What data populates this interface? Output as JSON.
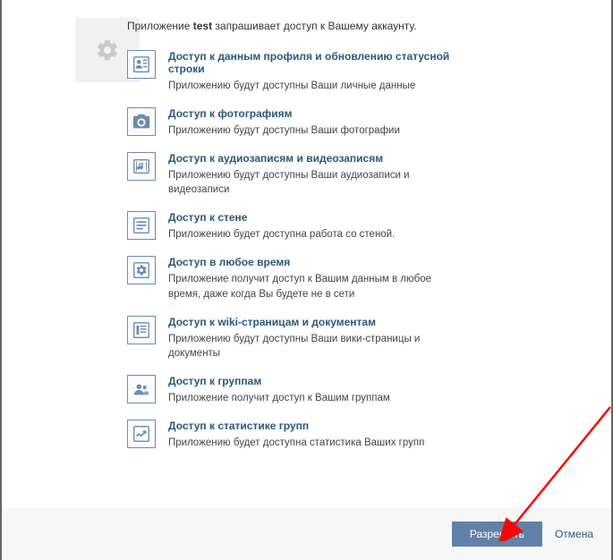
{
  "intro_prefix": "Приложение ",
  "app_name": "test",
  "intro_suffix": " запрашивает доступ к Вашему аккаунту.",
  "permissions": [
    {
      "icon": "profile",
      "title": "Доступ к данным профиля и обновлению статусной строки",
      "desc": "Приложению будут доступны Ваши личные данные"
    },
    {
      "icon": "photos",
      "title": "Доступ к фотографиям",
      "desc": "Приложению будут доступны Ваши фотографии"
    },
    {
      "icon": "audio",
      "title": "Доступ к аудиозаписям и видеозаписям",
      "desc": "Приложению будут доступны Ваши аудиозаписи и видеозаписи"
    },
    {
      "icon": "wall",
      "title": "Доступ к стене",
      "desc": "Приложению будет доступна работа со стеной."
    },
    {
      "icon": "offline",
      "title": "Доступ в любое время",
      "desc": "Приложение получит доступ к Вашим данным в любое время, даже когда Вы будете не в сети"
    },
    {
      "icon": "docs",
      "title": "Доступ к wiki-страницам и документам",
      "desc": "Приложению будут доступны Ваши вики-страницы и документы"
    },
    {
      "icon": "groups",
      "title": "Доступ к группам",
      "desc": "Приложение получит доступ к Вашим группам"
    },
    {
      "icon": "stats",
      "title": "Доступ к статистике групп",
      "desc": "Приложению будет доступна статистика Ваших групп"
    }
  ],
  "buttons": {
    "allow": "Разрешить",
    "cancel": "Отмена"
  }
}
